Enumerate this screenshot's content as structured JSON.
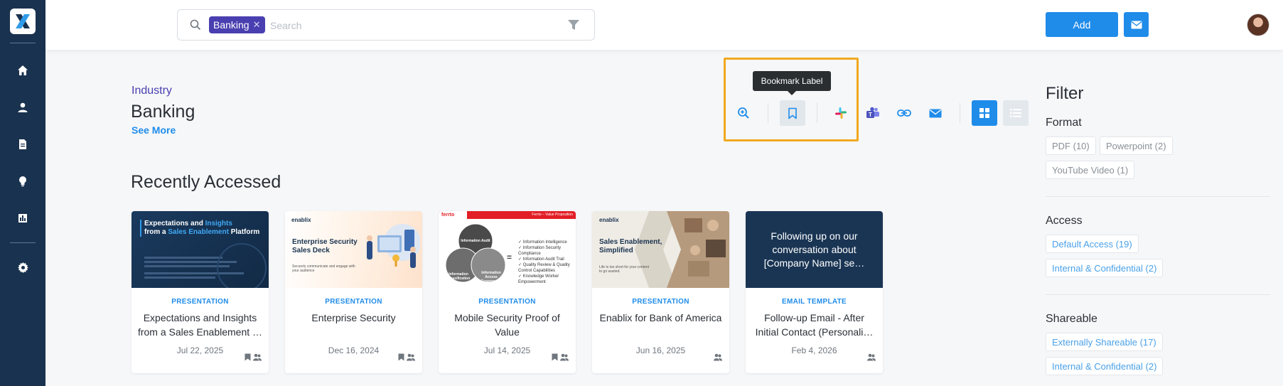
{
  "search": {
    "chip": "Banking",
    "placeholder": "Search"
  },
  "topbar": {
    "add_label": "Add"
  },
  "header": {
    "category": "Industry",
    "title": "Banking",
    "see_more": "See More"
  },
  "tooltip": "Bookmark Label",
  "section_title": "Recently Accessed",
  "cards": [
    {
      "type": "PRESENTATION",
      "title": "Expectations and Insights from a Sales Enablement …",
      "date": "Jul 22, 2025",
      "thumb_heading_1": "Expectations and ",
      "thumb_heading_hl1": "Insights",
      "thumb_heading_2": "from a ",
      "thumb_heading_hl2": "Sales Enablement",
      "thumb_heading_3": " Platform"
    },
    {
      "type": "PRESENTATION",
      "title": "Enterprise Security",
      "date": "Dec 16, 2024",
      "thumb_logo": "enablix",
      "thumb_heading": "Enterprise Security Sales Deck",
      "thumb_sub": "Securely communicate and engage with your audience"
    },
    {
      "type": "PRESENTATION",
      "title": "Mobile Security Proof of Value",
      "date": "Jul 14, 2025",
      "thumb_brand": "ferrto",
      "thumb_banner": "Ferrto – Value Proposition",
      "thumb_circles": [
        "Information Audit",
        "Information Classification",
        "Information Access Governance"
      ],
      "thumb_list": [
        "Information Intelligence",
        "Information Security Compliance",
        "Information Audit Trail",
        "Quality Review & Quality Control Capabilities",
        "Knowledge Worker Empowerment"
      ]
    },
    {
      "type": "PRESENTATION",
      "title": "Enablix for Bank of America",
      "date": "Jun 16, 2025",
      "thumb_logo": "enablix",
      "thumb_heading": "Sales Enablement, Simplified",
      "thumb_sub": "Life is too short for your content to go wasted."
    },
    {
      "type": "EMAIL TEMPLATE",
      "title": "Follow-up Email - After Initial Contact (Personali…",
      "date": "Feb 4, 2026",
      "thumb_text": "Following up on our conversation about [Company Name] se…"
    }
  ],
  "filter": {
    "title": "Filter",
    "groups": [
      {
        "label": "Format",
        "tags": [
          "PDF (10)",
          "Powerpoint (2)",
          "YouTube Video (1)"
        ]
      },
      {
        "label": "Access",
        "tags": [
          "Default Access (19)",
          "Internal & Confidential (2)"
        ]
      },
      {
        "label": "Shareable",
        "tags": [
          "Externally Shareable (17)",
          "Internal & Confidential (2)"
        ]
      }
    ]
  },
  "colors": {
    "sidebar": "#19324f",
    "accent": "#1f8cea",
    "chip": "#4a3fb0",
    "highlight": "#f1a81e"
  },
  "icons": {
    "sidebar": [
      "home-icon",
      "user-icon",
      "document-icon",
      "lightbulb-icon",
      "bar-chart-icon",
      "gear-icon"
    ],
    "toolbar": [
      "zoom-in-icon",
      "bookmark-icon",
      "slack-icon",
      "teams-icon",
      "link-icon",
      "mail-icon",
      "grid-view-icon",
      "list-view-icon"
    ]
  }
}
